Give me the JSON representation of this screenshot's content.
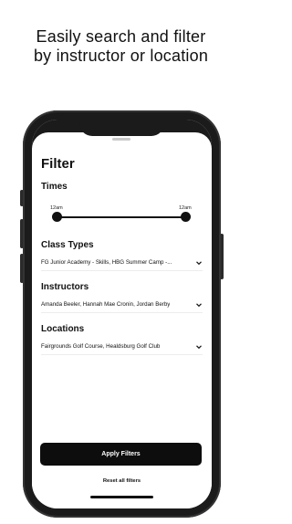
{
  "headline": {
    "line1": "Easily search and filter",
    "line2": "by instructor or location"
  },
  "filter": {
    "title": "Filter",
    "times": {
      "label": "Times",
      "start_label": "12am",
      "end_label": "12am"
    },
    "class_types": {
      "label": "Class Types",
      "value": "FG Junior Academy - Skills, HBG Summer Camp -..."
    },
    "instructors": {
      "label": "Instructors",
      "value": "Amanda Beeler, Hannah Mae Cronin, Jordan Berby"
    },
    "locations": {
      "label": "Locations",
      "value": "Fairgrounds Golf Course, Healdsburg Golf Club"
    },
    "apply_label": "Apply Filters",
    "reset_label": "Reset all filters"
  },
  "colors": {
    "primary_button": "#0d0d0d",
    "phone_frame": "#1b1b1b"
  }
}
